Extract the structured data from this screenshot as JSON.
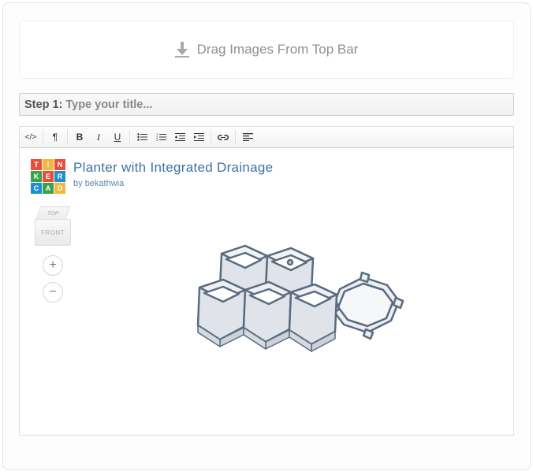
{
  "dropzone": {
    "label": "Drag Images From Top Bar"
  },
  "titleRow": {
    "prefix": "Step 1:",
    "placeholder": "Type your title..."
  },
  "embed": {
    "title": "Planter with Integrated Drainage",
    "bylinePrefix": "by ",
    "author": "bekathwia",
    "logoCells": [
      {
        "t": "T",
        "c": "#e84e3c"
      },
      {
        "t": "I",
        "c": "#f6b63b"
      },
      {
        "t": "N",
        "c": "#e84e3c"
      },
      {
        "t": "K",
        "c": "#3aa24a"
      },
      {
        "t": "E",
        "c": "#e84e3c"
      },
      {
        "t": "R",
        "c": "#1e8fcf"
      },
      {
        "t": "C",
        "c": "#1e8fcf"
      },
      {
        "t": "A",
        "c": "#3aa24a"
      },
      {
        "t": "D",
        "c": "#f6b63b"
      }
    ],
    "cube": {
      "top": "TOP",
      "front": "FRONT"
    },
    "zoom": {
      "in": "+",
      "out": "−"
    }
  }
}
